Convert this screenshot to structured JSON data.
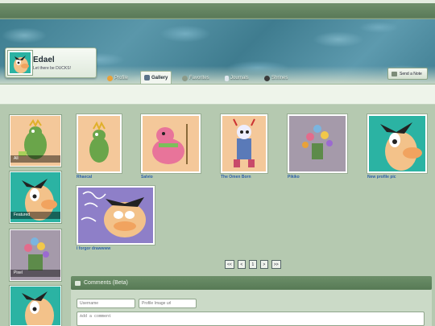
{
  "profile": {
    "username": "Edael",
    "tagline": "Let there be DUCKS!"
  },
  "nav": {
    "tabs": [
      {
        "label": "Profile",
        "icon": "profile-icon"
      },
      {
        "label": "Gallery",
        "icon": "gallery-icon",
        "active": true
      },
      {
        "label": "Favorites",
        "icon": "favorites-icon"
      },
      {
        "label": "Journals",
        "icon": "journals-icon"
      },
      {
        "label": "Shrines",
        "icon": "shrines-icon"
      }
    ],
    "send_note": "Send a Note"
  },
  "folders": [
    {
      "label": "All"
    },
    {
      "label": "Featured"
    },
    {
      "label": "Pixel"
    }
  ],
  "gallery": [
    {
      "caption": "Rhaecal"
    },
    {
      "caption": "Salvio"
    },
    {
      "caption": "The Omen Born"
    },
    {
      "caption": "Pikiko"
    },
    {
      "caption": "New profile pic"
    },
    {
      "caption": "I forgor drawwww"
    }
  ],
  "pagination": {
    "first": "<<",
    "prev": "<",
    "current": "1",
    "next": ">",
    "last": ">>"
  },
  "comments": {
    "title": "Comments (Beta)",
    "username_placeholder": "Username",
    "image_placeholder": "Profile Image url",
    "comment_placeholder": "Add a comment"
  },
  "colors": {
    "page_bg": "#b5c9b0",
    "banner": "#4a8ba0",
    "link": "#2b5fa8",
    "header_bar": "#5a7a58"
  }
}
